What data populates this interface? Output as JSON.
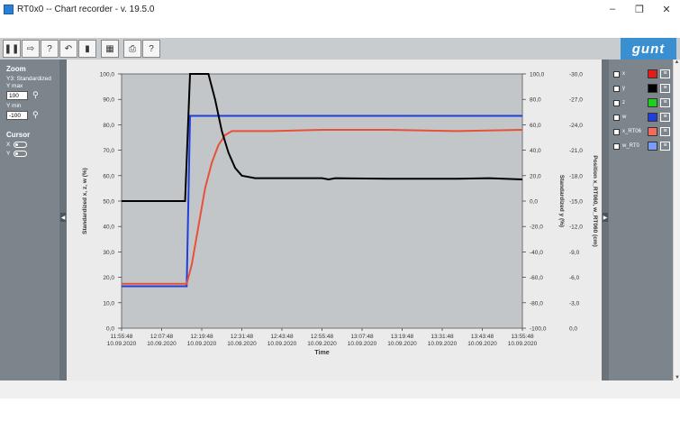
{
  "window": {
    "title": "RT0x0  --  Chart recorder - v. 19.5.0"
  },
  "toolbar": {
    "logo_text": "gunt"
  },
  "left_panel": {
    "zoom_heading": "Zoom",
    "zoom_axis": "Y3: Standardized",
    "ymax_label": "Y max",
    "ymax_value": "100",
    "ymin_label": "Y min",
    "ymin_value": "-100",
    "cursor_heading": "Cursor",
    "cursor_x_label": "X",
    "cursor_y_label": "Y"
  },
  "channels": [
    {
      "name": "x",
      "color": "#e31b1b"
    },
    {
      "name": "y",
      "color": "#000000"
    },
    {
      "name": "z",
      "color": "#1ed01e"
    },
    {
      "name": "w",
      "color": "#1f3fd8"
    },
    {
      "name": "x_RT06",
      "color": "#f26b5b"
    },
    {
      "name": "w_RT0",
      "color": "#7b9bf5"
    }
  ],
  "chart_data": {
    "type": "line",
    "xlabel": "Time",
    "x_ticks": [
      "11:55:48",
      "12:07:48",
      "12:19:48",
      "12:31:48",
      "12:43:48",
      "12:55:48",
      "13:07:48",
      "13:19:48",
      "13:31:48",
      "13:43:48",
      "13:55:48"
    ],
    "x_tick_date": "10.09.2020",
    "y_left": {
      "label": "Standardized  x, z, w   (%)",
      "ticks": [
        "100,0",
        "90,0",
        "80,0",
        "70,0",
        "60,0",
        "50,0",
        "40,0",
        "30,0",
        "20,0",
        "10,0",
        "0,0"
      ],
      "ylim": [
        0,
        100
      ]
    },
    "y_right1": {
      "label": "Standardized  y   (%)",
      "ticks": [
        "100,0",
        "80,0",
        "60,0",
        "40,0",
        "20,0",
        "0,0",
        "-20,0",
        "-40,0",
        "-60,0",
        "-80,0",
        "-100,0"
      ],
      "ylim": [
        -100,
        100
      ]
    },
    "y_right2": {
      "label": "Position  x_RT060, w_RT060   (cm)",
      "ticks": [
        "-30,0",
        "-27,0",
        "-24,0",
        "-21,0",
        "-18,0",
        "-15,0",
        "-12,0",
        "-9,0",
        "-6,0",
        "-3,0",
        "0,0"
      ],
      "ylim": [
        0,
        -30
      ]
    },
    "x_range_minutes": [
      0,
      120
    ],
    "grid": false,
    "series": [
      {
        "color": "#1f3fd8",
        "axis": "left",
        "points": [
          [
            0,
            16.5
          ],
          [
            19.5,
            16.5
          ],
          [
            20.5,
            83.5
          ],
          [
            120,
            83.5
          ]
        ]
      },
      {
        "color": "#e8503a",
        "axis": "left",
        "points": [
          [
            0,
            17.5
          ],
          [
            19.5,
            17.5
          ],
          [
            21,
            25
          ],
          [
            23,
            40
          ],
          [
            25,
            55
          ],
          [
            27,
            65
          ],
          [
            29,
            72
          ],
          [
            31,
            76
          ],
          [
            33,
            77.5
          ],
          [
            45,
            77.5
          ],
          [
            60,
            78
          ],
          [
            80,
            78
          ],
          [
            100,
            77.5
          ],
          [
            120,
            78
          ]
        ]
      },
      {
        "color": "#000000",
        "axis": "right1",
        "points": [
          [
            0,
            0
          ],
          [
            19,
            0
          ],
          [
            20.5,
            100
          ],
          [
            26,
            100
          ],
          [
            28,
            80
          ],
          [
            30,
            55
          ],
          [
            32,
            38
          ],
          [
            34,
            26
          ],
          [
            36,
            20
          ],
          [
            40,
            18
          ],
          [
            60,
            18
          ],
          [
            62,
            17
          ],
          [
            64,
            18
          ],
          [
            80,
            17.5
          ],
          [
            100,
            17.5
          ],
          [
            110,
            18
          ],
          [
            120,
            17
          ]
        ]
      }
    ]
  }
}
